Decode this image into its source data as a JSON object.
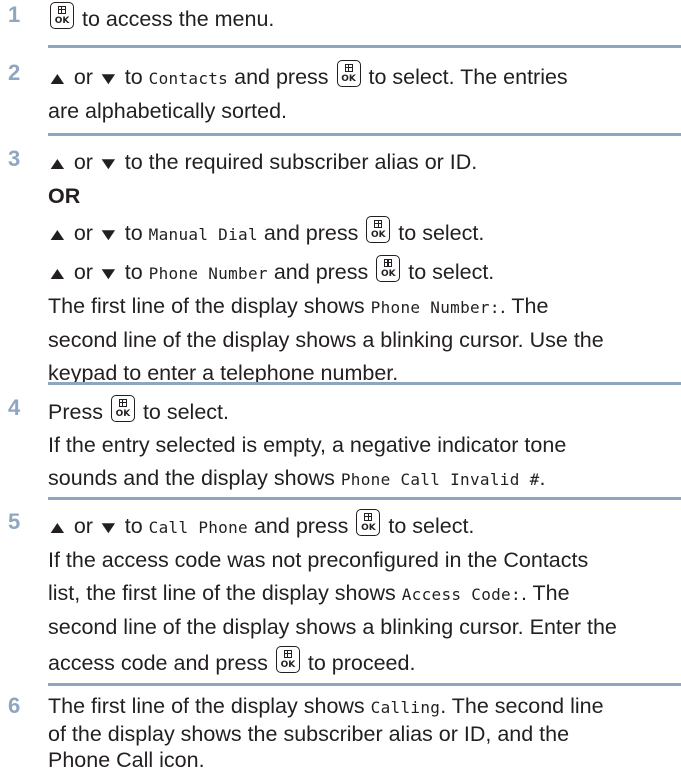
{
  "icons": {
    "ok_key": "menu-ok-key-icon",
    "up": "up-arrow-key-icon",
    "down": "down-arrow-key-icon"
  },
  "colors": {
    "step_number": "#8fa6c0",
    "separator": "#8fa6c0",
    "text": "#231f20"
  },
  "steps": [
    {
      "number": "1",
      "text_access": "to access the menu."
    },
    {
      "number": "2",
      "or": "or",
      "to": "to",
      "target": "Contacts",
      "and_press": "and press",
      "to_select": "to select. The entries",
      "line2": "are alphabetically sorted."
    },
    {
      "number": "3",
      "or": "or",
      "line1": "to the required subscriber alias or ID.",
      "or_label": "OR",
      "sub_a": {
        "or": "or",
        "to": "to",
        "target": "Manual Dial",
        "and_press": "and press",
        "to_select": "to select."
      },
      "sub_b": {
        "or": "or",
        "to": "to",
        "target": "Phone Number",
        "and_press": "and press",
        "to_select": "to select."
      },
      "p_line1_pre": "The first line of the display shows",
      "p_line1_mono": "Phone Number:",
      "p_line1_post": ". The",
      "p_line2": "second line of the display shows a blinking cursor. Use the",
      "p_line3": "keypad to enter a telephone number."
    },
    {
      "number": "4",
      "press": "Press",
      "to_select": "to select.",
      "line2": "If the entry selected is empty, a negative indicator tone",
      "line3_pre": "sounds and the display shows",
      "line3_mono": "Phone Call Invalid #",
      "line3_post": "."
    },
    {
      "number": "5",
      "or": "or",
      "to": "to",
      "target": "Call Phone",
      "and_press": "and press",
      "to_select": "to select.",
      "line2": "If the access code was not preconfigured in the Contacts",
      "line3_pre": "list, the first line of the display shows",
      "line3_mono": "Access Code:",
      "line3_post": ". The",
      "line4": "second line of the display shows a blinking cursor. Enter the",
      "line5_pre": "access code and press",
      "line5_post": "to proceed."
    },
    {
      "number": "6",
      "line1_pre": "The first line of the display shows",
      "line1_mono": "Calling",
      "line1_post": ". The second line",
      "line2": "of the display shows the subscriber alias or ID, and the",
      "line3": "Phone Call icon."
    }
  ]
}
